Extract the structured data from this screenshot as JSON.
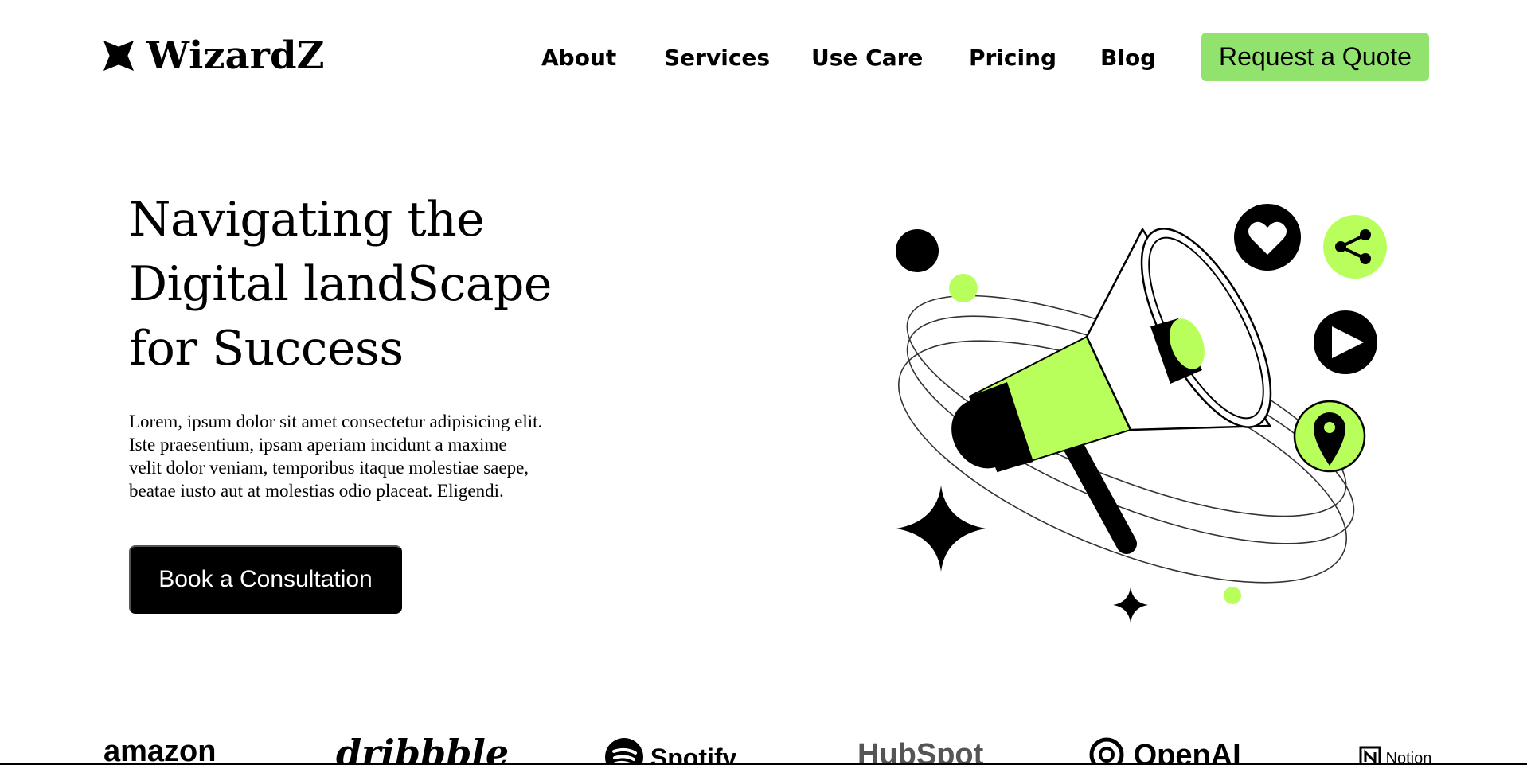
{
  "brand": {
    "name": "WizardZ"
  },
  "nav": {
    "items": [
      {
        "label": "About"
      },
      {
        "label": "Services"
      },
      {
        "label": "Use Care"
      },
      {
        "label": "Pricing"
      },
      {
        "label": "Blog"
      }
    ],
    "cta_label": "Request a Quote"
  },
  "hero": {
    "title_line1": "Navigating the",
    "title_line2": "Digital landScape",
    "title_line3": "for Success",
    "body": "Lorem, ipsum dolor sit amet consectetur adipisicing elit. Iste praesentium, ipsam aperiam incidunt a maxime velit dolor veniam, temporibus itaque molestiae saepe, beatae iusto aut at molestias odio placeat. Eligendi.",
    "cta_label": "Book a Consultation"
  },
  "brands": [
    {
      "name": "amazon"
    },
    {
      "name": "dribbble"
    },
    {
      "name": "Spotify"
    },
    {
      "name": "HubSpot"
    },
    {
      "name": "OpenAI"
    },
    {
      "name": "Notion"
    }
  ],
  "colors": {
    "accent": "#92e36e",
    "lime": "#b8ff5c",
    "ink": "#000000",
    "bg": "#ffffff"
  },
  "icons": [
    "logo-mark-icon",
    "megaphone-icon",
    "heart-icon",
    "share-icon",
    "play-icon",
    "location-pin-icon",
    "sparkle-star-icon"
  ]
}
